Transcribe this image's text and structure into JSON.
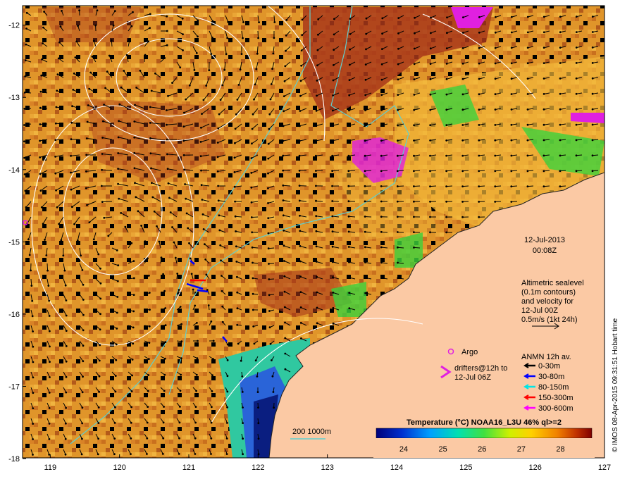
{
  "map": {
    "lon_ticks": [
      "119",
      "120",
      "121",
      "122",
      "123",
      "124",
      "125",
      "126",
      "127"
    ],
    "lat_ticks": [
      "-12",
      "-13",
      "-14",
      "-15",
      "-16",
      "-17",
      "-18"
    ],
    "lon_range": [
      118.6,
      127.0
    ],
    "lat_range": [
      -17.99,
      -11.73
    ]
  },
  "annotation": {
    "date": "12-Jul-2013",
    "time": "00:08Z",
    "altimetry_lines": [
      "Altimetric sealevel",
      "(0.1m contours)",
      "and velocity for",
      "12-Jul 00Z",
      "0.5m/s (1kt 24h)"
    ]
  },
  "legend": {
    "argo_label": "Argo",
    "drifters_line1": "drifters@12h to",
    "drifters_line2": "12-Jul 06Z",
    "anmn_title": "ANMN 12h av.",
    "anmn_items": [
      {
        "label": "0-30m",
        "color": "#000000"
      },
      {
        "label": "30-80m",
        "color": "#0000ff"
      },
      {
        "label": "80-150m",
        "color": "#00e5e5"
      },
      {
        "label": "150-300m",
        "color": "#ff0000"
      },
      {
        "label": "300-600m",
        "color": "#ff00ff"
      }
    ],
    "isobath_label": "200  1000m"
  },
  "colorbar": {
    "title": "Temperature (°C) NOAA16_L3U 46% ql>=2",
    "ticks": [
      "24",
      "25",
      "26",
      "27",
      "28"
    ],
    "range": [
      23.3,
      28.8
    ]
  },
  "credit": "© IMOS 08-Apr-2015 09:31:51 Hobart time",
  "colors": {
    "land": "#fbc9a4",
    "sst_warm": "#e09a2a",
    "sst_hot": "#a0300f",
    "sst_cool": "#2a64d8",
    "contour": "#ffffff",
    "isobath": "#5fd0d0",
    "argo": "#e020e0"
  }
}
